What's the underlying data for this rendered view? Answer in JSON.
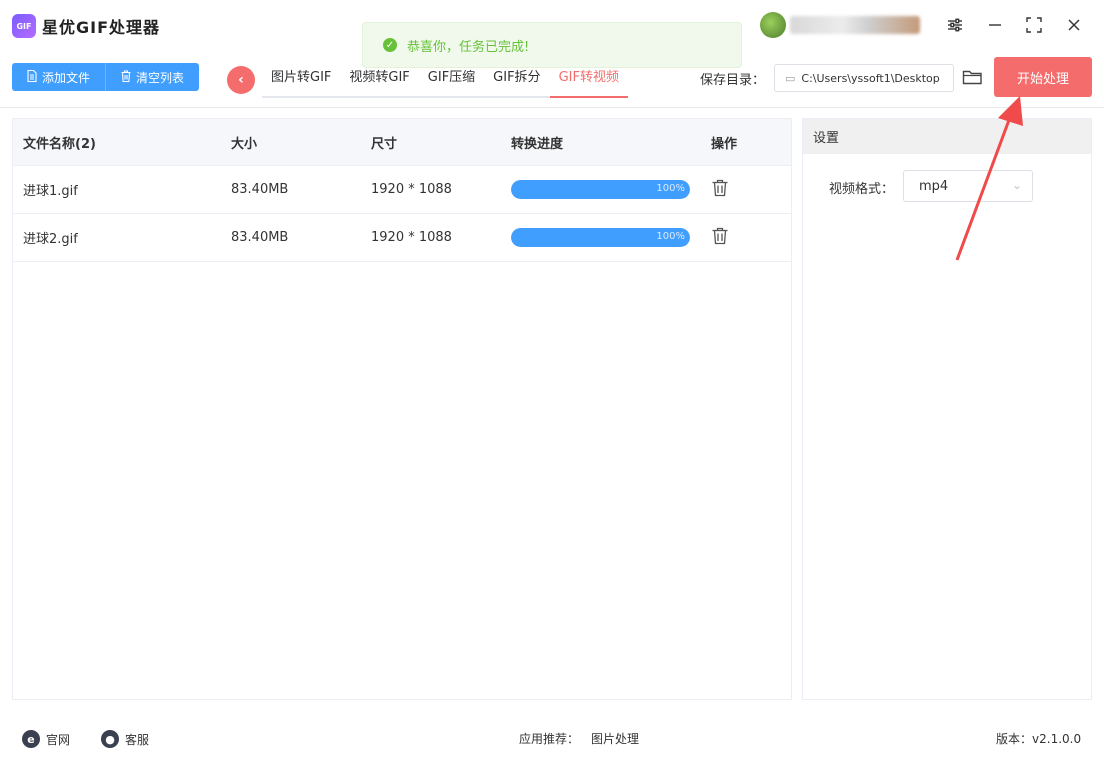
{
  "app": {
    "title": "星优GIF处理器",
    "logo_text": "GIF"
  },
  "toast": {
    "message": "恭喜你，任务已完成!"
  },
  "toolbar": {
    "add_file": "添加文件",
    "clear_list": "清空列表",
    "save_label": "保存目录：",
    "save_path": "C:\\Users\\yssoft1\\Desktop",
    "start_button": "开始处理"
  },
  "tabs": [
    {
      "label": "图片转GIF",
      "active": false
    },
    {
      "label": "视频转GIF",
      "active": false
    },
    {
      "label": "GIF压缩",
      "active": false
    },
    {
      "label": "GIF拆分",
      "active": false
    },
    {
      "label": "GIF转视频",
      "active": true
    }
  ],
  "table": {
    "headers": {
      "name": "文件名称(2)",
      "size": "大小",
      "dimensions": "尺寸",
      "progress": "转换进度",
      "operation": "操作"
    },
    "rows": [
      {
        "name": "进球1.gif",
        "size": "83.40MB",
        "dimensions": "1920 * 1088",
        "progress_text": "100%",
        "progress": 1.0
      },
      {
        "name": "进球2.gif",
        "size": "83.40MB",
        "dimensions": "1920 * 1088",
        "progress_text": "100%",
        "progress": 1.0
      }
    ]
  },
  "settings": {
    "title": "设置",
    "format_label": "视频格式：",
    "format_value": "mp4"
  },
  "footer": {
    "website": "官网",
    "support": "客服",
    "recommend_label": "应用推荐：",
    "recommend_value": "图片处理",
    "version_label": "版本：",
    "version_value": "v2.1.0.0"
  },
  "colors": {
    "primary_blue": "#409eff",
    "accent_red": "#f56c6c",
    "success_green": "#67c23a"
  }
}
